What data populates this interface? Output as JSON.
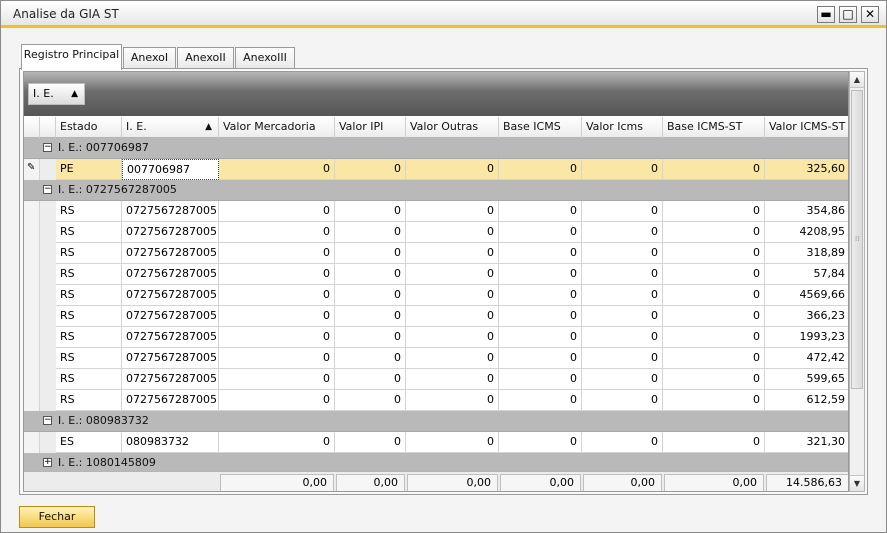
{
  "window": {
    "title": "Analise da GIA ST",
    "minimize_glyph": "▬",
    "maximize_glyph": "□",
    "close_glyph": "✕"
  },
  "tabs": [
    {
      "label": "Registro Principal",
      "active": true
    },
    {
      "label": "AnexoI",
      "active": false
    },
    {
      "label": "AnexoII",
      "active": false
    },
    {
      "label": "AnexoIII",
      "active": false
    }
  ],
  "grouping": {
    "label": "I. E.",
    "sort_glyph": "▲"
  },
  "columns": [
    {
      "label": "Estado"
    },
    {
      "label": "I. E.",
      "sort_glyph": "▲"
    },
    {
      "label": "Valor Mercadoria"
    },
    {
      "label": "Valor IPI"
    },
    {
      "label": "Valor Outras"
    },
    {
      "label": "Base ICMS"
    },
    {
      "label": "Valor Icms"
    },
    {
      "label": "Base ICMS-ST"
    },
    {
      "label": "Valor ICMS-ST"
    }
  ],
  "groups": [
    {
      "label": "I. E.: 007706987",
      "toggle": "−",
      "rows": [
        {
          "estado": "PE",
          "ie": "007706987",
          "valor_mercadoria": "0",
          "valor_ipi": "0",
          "valor_outras": "0",
          "base_icms": "0",
          "valor_icms": "0",
          "base_icms_st": "0",
          "valor_icms_st": "325,60",
          "selected": true
        }
      ]
    },
    {
      "label": "I. E.: 0727567287005",
      "toggle": "−",
      "rows": [
        {
          "estado": "RS",
          "ie": "0727567287005",
          "valor_mercadoria": "0",
          "valor_ipi": "0",
          "valor_outras": "0",
          "base_icms": "0",
          "valor_icms": "0",
          "base_icms_st": "0",
          "valor_icms_st": "354,86"
        },
        {
          "estado": "RS",
          "ie": "0727567287005",
          "valor_mercadoria": "0",
          "valor_ipi": "0",
          "valor_outras": "0",
          "base_icms": "0",
          "valor_icms": "0",
          "base_icms_st": "0",
          "valor_icms_st": "4208,95"
        },
        {
          "estado": "RS",
          "ie": "0727567287005",
          "valor_mercadoria": "0",
          "valor_ipi": "0",
          "valor_outras": "0",
          "base_icms": "0",
          "valor_icms": "0",
          "base_icms_st": "0",
          "valor_icms_st": "318,89"
        },
        {
          "estado": "RS",
          "ie": "0727567287005",
          "valor_mercadoria": "0",
          "valor_ipi": "0",
          "valor_outras": "0",
          "base_icms": "0",
          "valor_icms": "0",
          "base_icms_st": "0",
          "valor_icms_st": "57,84"
        },
        {
          "estado": "RS",
          "ie": "0727567287005",
          "valor_mercadoria": "0",
          "valor_ipi": "0",
          "valor_outras": "0",
          "base_icms": "0",
          "valor_icms": "0",
          "base_icms_st": "0",
          "valor_icms_st": "4569,66"
        },
        {
          "estado": "RS",
          "ie": "0727567287005",
          "valor_mercadoria": "0",
          "valor_ipi": "0",
          "valor_outras": "0",
          "base_icms": "0",
          "valor_icms": "0",
          "base_icms_st": "0",
          "valor_icms_st": "366,23"
        },
        {
          "estado": "RS",
          "ie": "0727567287005",
          "valor_mercadoria": "0",
          "valor_ipi": "0",
          "valor_outras": "0",
          "base_icms": "0",
          "valor_icms": "0",
          "base_icms_st": "0",
          "valor_icms_st": "1993,23"
        },
        {
          "estado": "RS",
          "ie": "0727567287005",
          "valor_mercadoria": "0",
          "valor_ipi": "0",
          "valor_outras": "0",
          "base_icms": "0",
          "valor_icms": "0",
          "base_icms_st": "0",
          "valor_icms_st": "472,42"
        },
        {
          "estado": "RS",
          "ie": "0727567287005",
          "valor_mercadoria": "0",
          "valor_ipi": "0",
          "valor_outras": "0",
          "base_icms": "0",
          "valor_icms": "0",
          "base_icms_st": "0",
          "valor_icms_st": "599,65"
        },
        {
          "estado": "RS",
          "ie": "0727567287005",
          "valor_mercadoria": "0",
          "valor_ipi": "0",
          "valor_outras": "0",
          "base_icms": "0",
          "valor_icms": "0",
          "base_icms_st": "0",
          "valor_icms_st": "612,59"
        }
      ]
    },
    {
      "label": "I. E.: 080983732",
      "toggle": "−",
      "rows": [
        {
          "estado": "ES",
          "ie": "080983732",
          "valor_mercadoria": "0",
          "valor_ipi": "0",
          "valor_outras": "0",
          "base_icms": "0",
          "valor_icms": "0",
          "base_icms_st": "0",
          "valor_icms_st": "321,30"
        }
      ]
    },
    {
      "label": "I. E.: 1080145809",
      "toggle": "+",
      "rows": []
    }
  ],
  "totals": {
    "valor_mercadoria": "0,00",
    "valor_ipi": "0,00",
    "valor_outras": "0,00",
    "base_icms": "0,00",
    "valor_icms": "0,00",
    "base_icms_st": "0,00",
    "valor_icms_st": "14.586,63"
  },
  "scroll": {
    "up_glyph": "▲",
    "down_glyph": "▼",
    "grip_glyph": "⁞⁞"
  },
  "row_indicator_glyph": "✎",
  "buttons": {
    "close_label": "Fechar"
  }
}
